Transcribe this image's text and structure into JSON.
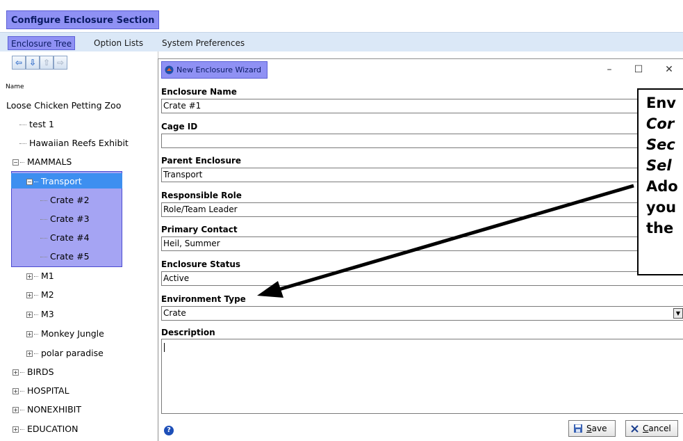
{
  "app": {
    "title": "Configure Enclosure Section"
  },
  "tabs": [
    {
      "label": "Enclosure Tree"
    },
    {
      "label": "Option Lists"
    },
    {
      "label": "System Preferences"
    }
  ],
  "tree": {
    "column_header": "Name",
    "toolbar": {
      "back_icon": "arrow-left-icon",
      "down_icon": "arrow-down-icon",
      "up_icon": "arrow-up-icon",
      "forward_icon": "arrow-right-icon"
    },
    "nodes": [
      {
        "label": "Loose Chicken Petting Zoo"
      },
      {
        "label": "test 1"
      },
      {
        "label": "Hawaiian Reefs Exhibit"
      },
      {
        "label": "MAMMALS"
      },
      {
        "label": "Transport"
      },
      {
        "label": "Crate #2"
      },
      {
        "label": "Crate #3"
      },
      {
        "label": "Crate #4"
      },
      {
        "label": "Crate #5"
      },
      {
        "label": "M1"
      },
      {
        "label": "M2"
      },
      {
        "label": "M3"
      },
      {
        "label": "Monkey Jungle"
      },
      {
        "label": "polar paradise"
      },
      {
        "label": "BIRDS"
      },
      {
        "label": "HOSPITAL"
      },
      {
        "label": "NONEXHIBIT"
      },
      {
        "label": "EDUCATION"
      }
    ]
  },
  "dialog": {
    "title": "New Enclosure Wizard",
    "window_controls": {
      "minimize": "–",
      "maximize": "☐",
      "close": "✕"
    },
    "fields": [
      {
        "label": "Enclosure Name",
        "value": "Crate #1"
      },
      {
        "label": "Cage ID",
        "value": ""
      },
      {
        "label": "Parent Enclosure",
        "value": "Transport"
      },
      {
        "label": "Responsible Role",
        "value": "Role/Team Leader"
      },
      {
        "label": "Primary Contact",
        "value": "Heil, Summer"
      },
      {
        "label": "Enclosure Status",
        "value": "Active"
      },
      {
        "label": "Environment Type",
        "value": "Crate"
      }
    ],
    "description": {
      "label": "Description",
      "value": ""
    },
    "buttons": {
      "save_prefix": "",
      "save_underline": "S",
      "save_rest": "ave",
      "cancel_underline": "C",
      "cancel_rest": "ancel"
    }
  },
  "callout": {
    "lines": [
      "Env",
      "Cor",
      "Sec",
      "Sel",
      "Ado",
      "you",
      "the"
    ]
  },
  "colors": {
    "highlight": "#8f91f4",
    "selection": "#3d8ff0",
    "tabbar": "#dbe8f7"
  }
}
